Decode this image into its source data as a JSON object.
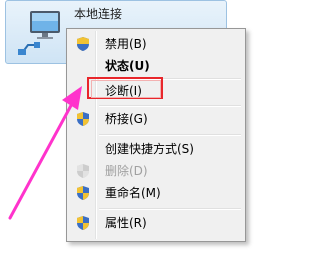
{
  "adapter": {
    "title": "本地连接",
    "icon": "network-adapter-icon"
  },
  "menu": {
    "items": [
      {
        "label": "禁用(B)",
        "icon": "uac-shield-icon",
        "bold": false,
        "disabled": false
      },
      {
        "label": "状态(U)",
        "icon": "",
        "bold": true,
        "disabled": false
      },
      {
        "label": "诊断(I)",
        "icon": "",
        "bold": false,
        "disabled": false
      },
      {
        "label": "桥接(G)",
        "icon": "uac-shield-icon",
        "bold": false,
        "disabled": false
      },
      {
        "label": "创建快捷方式(S)",
        "icon": "",
        "bold": false,
        "disabled": false
      },
      {
        "label": "删除(D)",
        "icon": "uac-shield-icon",
        "bold": false,
        "disabled": true
      },
      {
        "label": "重命名(M)",
        "icon": "uac-shield-icon",
        "bold": false,
        "disabled": false
      },
      {
        "label": "属性(R)",
        "icon": "uac-shield-icon",
        "bold": false,
        "disabled": false
      }
    ]
  },
  "annotation": {
    "highlight_color": "#e8262b",
    "arrow_color": "#ff33cc"
  }
}
